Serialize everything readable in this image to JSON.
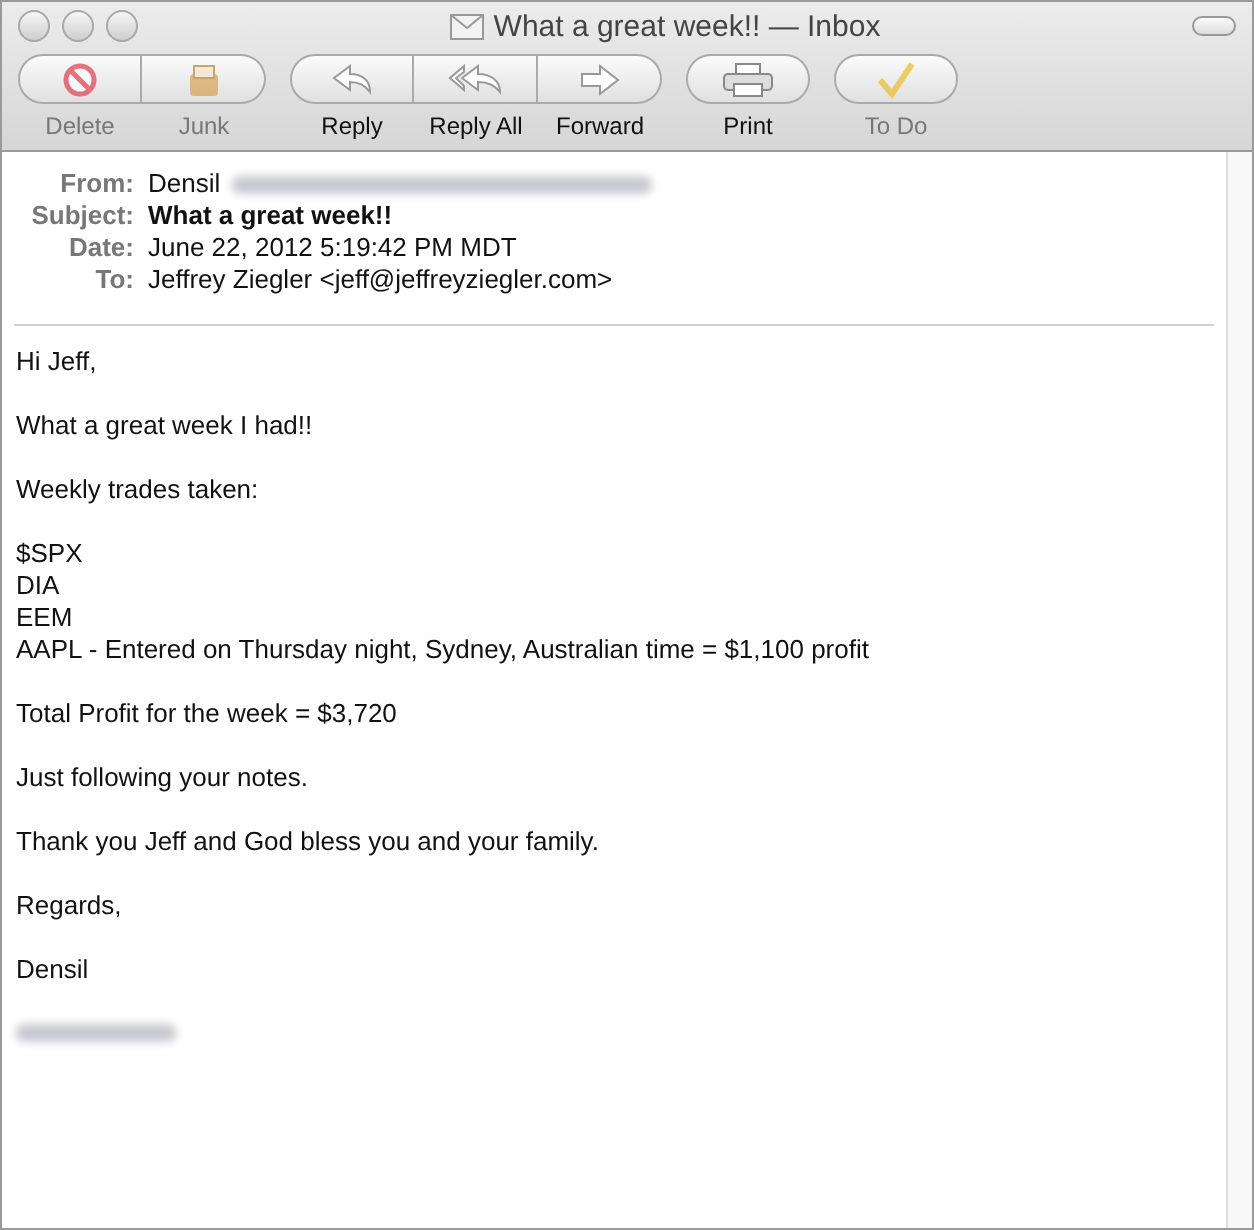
{
  "window": {
    "title": "What a great week!! — Inbox"
  },
  "toolbar": [
    {
      "label": "Delete",
      "disabled": true
    },
    {
      "label": "Junk",
      "disabled": true
    },
    {
      "label": "Reply",
      "disabled": false
    },
    {
      "label": "Reply All",
      "disabled": false
    },
    {
      "label": "Forward",
      "disabled": false
    },
    {
      "label": "Print",
      "disabled": false
    },
    {
      "label": "To Do",
      "disabled": true
    }
  ],
  "headers": [
    {
      "label": "From:",
      "value": "Densil",
      "bold": false,
      "redacted": true
    },
    {
      "label": "Subject:",
      "value": "What a great week!!",
      "bold": true
    },
    {
      "label": "Date:",
      "value": "June 22, 2012 5:19:42 PM MDT",
      "bold": false
    },
    {
      "label": "To:",
      "value": "Jeffrey Ziegler <jeff@jeffreyziegler.com>",
      "bold": false
    }
  ],
  "body": [
    {
      "kind": "text",
      "lines": [
        "Hi Jeff,"
      ]
    },
    {
      "kind": "text",
      "lines": [
        "What a great week I had!!"
      ]
    },
    {
      "kind": "text",
      "lines": [
        "Weekly trades taken:"
      ]
    },
    {
      "kind": "text",
      "lines": [
        "$SPX",
        "DIA",
        "EEM",
        "AAPL - Entered on Thursday night, Sydney, Australian time = $1,100 profit"
      ]
    },
    {
      "kind": "text",
      "lines": [
        "Total Profit for the week = $3,720"
      ]
    },
    {
      "kind": "text",
      "lines": [
        "Just following your notes."
      ]
    },
    {
      "kind": "text",
      "lines": [
        "Thank you Jeff and God bless you and your family."
      ]
    },
    {
      "kind": "closing",
      "lines": [
        "Regards,"
      ]
    },
    {
      "kind": "text",
      "lines": [
        "Densil"
      ]
    },
    {
      "kind": "redacted"
    }
  ]
}
